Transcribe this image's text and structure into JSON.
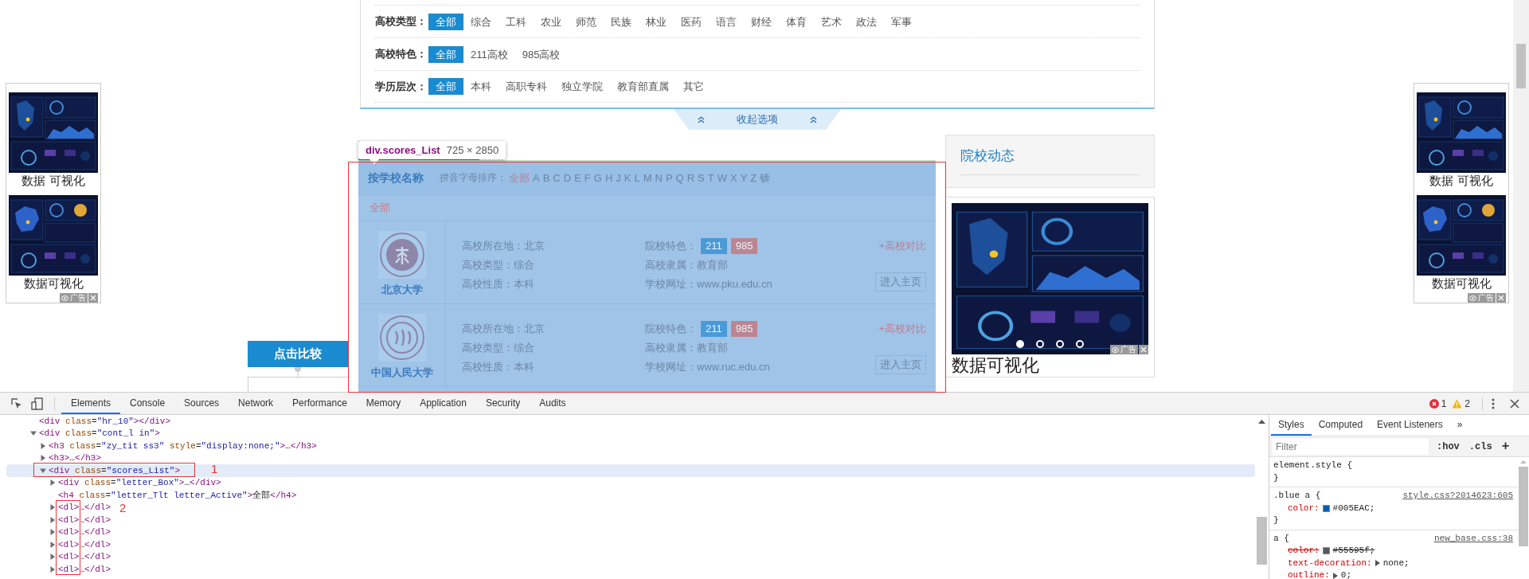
{
  "page": {
    "filters": [
      {
        "label": "高校类型：",
        "options": [
          {
            "label": "全部",
            "selected": true
          },
          {
            "label": "综合",
            "selected": false
          },
          {
            "label": "工科",
            "selected": false
          },
          {
            "label": "农业",
            "selected": false
          },
          {
            "label": "师范",
            "selected": false
          },
          {
            "label": "民族",
            "selected": false
          },
          {
            "label": "林业",
            "selected": false
          },
          {
            "label": "医药",
            "selected": false
          },
          {
            "label": "语言",
            "selected": false
          },
          {
            "label": "财经",
            "selected": false
          },
          {
            "label": "体育",
            "selected": false
          },
          {
            "label": "艺术",
            "selected": false
          },
          {
            "label": "政法",
            "selected": false
          },
          {
            "label": "军事",
            "selected": false
          }
        ]
      },
      {
        "label": "高校特色：",
        "options": [
          {
            "label": "全部",
            "selected": true
          },
          {
            "label": "211高校",
            "selected": false
          },
          {
            "label": "985高校",
            "selected": false
          }
        ]
      },
      {
        "label": "学历层次：",
        "options": [
          {
            "label": "全部",
            "selected": true
          },
          {
            "label": "本科",
            "selected": false
          },
          {
            "label": "高职专科",
            "selected": false
          },
          {
            "label": "独立学院",
            "selected": false
          },
          {
            "label": "教育部直属",
            "selected": false
          },
          {
            "label": "其它",
            "selected": false
          }
        ]
      }
    ],
    "collapse_button": "收起选项",
    "scores_list": {
      "title": "按学校名称",
      "sort_label": "拼音字母排序：",
      "letters": [
        {
          "label": "全部",
          "selected": true
        },
        {
          "label": "A",
          "selected": false
        },
        {
          "label": "B",
          "selected": false
        },
        {
          "label": "C",
          "selected": false
        },
        {
          "label": "D",
          "selected": false
        },
        {
          "label": "E",
          "selected": false
        },
        {
          "label": "F",
          "selected": false
        },
        {
          "label": "G",
          "selected": false
        },
        {
          "label": "H",
          "selected": false
        },
        {
          "label": "J",
          "selected": false
        },
        {
          "label": "K",
          "selected": false
        },
        {
          "label": "L",
          "selected": false
        },
        {
          "label": "M",
          "selected": false
        },
        {
          "label": "N",
          "selected": false
        },
        {
          "label": "P",
          "selected": false
        },
        {
          "label": "Q",
          "selected": false
        },
        {
          "label": "R",
          "selected": false
        },
        {
          "label": "S",
          "selected": false
        },
        {
          "label": "T",
          "selected": false
        },
        {
          "label": "W",
          "selected": false
        },
        {
          "label": "X",
          "selected": false
        },
        {
          "label": "Y",
          "selected": false
        },
        {
          "label": "Z",
          "selected": false
        },
        {
          "label": "锛",
          "selected": false
        }
      ],
      "group_title": "全部",
      "schools": [
        {
          "name": "北京大学",
          "info": [
            "高校所在地：北京",
            "高校类型：综合",
            "高校性质：本科"
          ],
          "features_label": "院校特色：",
          "badges": [
            {
              "label": "211",
              "color": "#4a9ad8"
            },
            {
              "label": "985",
              "color": "#bc8592"
            }
          ],
          "affiliation": "高校隶属：教育部",
          "website": "学校网址：www.pku.edu.cn",
          "compare_link": "+高校对比",
          "homepage_button": "进入主页"
        },
        {
          "name": "中国人民大学",
          "info": [
            "高校所在地：北京",
            "高校类型：综合",
            "高校性质：本科"
          ],
          "features_label": "院校特色：",
          "badges": [
            {
              "label": "211",
              "color": "#4a9ad8"
            },
            {
              "label": "985",
              "color": "#bc8592"
            }
          ],
          "affiliation": "高校隶属：教育部",
          "website": "学校网址：www.ruc.edu.cn",
          "compare_link": "+高校对比",
          "homepage_button": "进入主页"
        }
      ]
    },
    "news_title": "院校动态",
    "right_ad": {
      "caption": "数据可视化",
      "badge": "广告",
      "slides": [
        {
          "selected": true
        },
        {
          "selected": false
        },
        {
          "selected": false
        },
        {
          "selected": false
        }
      ]
    },
    "side_ads": [
      {
        "captions": [
          "数据 可视化",
          "数据可视化"
        ],
        "badge": "广告"
      },
      {
        "captions": [
          "数据 可视化",
          "数据可视化"
        ],
        "badge": "广告"
      }
    ],
    "compare_button": "点击比较"
  },
  "inspector_tooltip": {
    "selector": "div.scores_List",
    "size": "725 × 2850"
  },
  "annotations": [
    {
      "label": "1"
    },
    {
      "label": "2"
    }
  ],
  "devtools": {
    "tabs": [
      {
        "label": "Elements",
        "selected": true
      },
      {
        "label": "Console",
        "selected": false
      },
      {
        "label": "Sources",
        "selected": false
      },
      {
        "label": "Network",
        "selected": false
      },
      {
        "label": "Performance",
        "selected": false
      },
      {
        "label": "Memory",
        "selected": false
      },
      {
        "label": "Application",
        "selected": false
      },
      {
        "label": "Security",
        "selected": false
      },
      {
        "label": "Audits",
        "selected": false
      }
    ],
    "errors": "1",
    "warnings": "2",
    "dom_tree": [
      {
        "markup": "<div class=\"hr_10\"></div>",
        "selected": false
      },
      {
        "markup": "<div class=\"cont_l in\">",
        "expanded": true,
        "selected": false,
        "children": [
          {
            "markup": "<h3 class=\"zy_tit ss3\" style=\"display:none;\">…</h3>",
            "expanded": false,
            "selected": false
          },
          {
            "markup": "<h3>…</h3>",
            "expanded": false,
            "selected": false
          },
          {
            "markup": "<div class=\"scores_List\">",
            "expanded": true,
            "selected": true,
            "children": [
              {
                "markup": "<div class=\"letter_Box\">…</div>",
                "expanded": false,
                "selected": false
              },
              {
                "markup": "<h4 class=\"letter_Tlt letter_Active\">全部</h4>",
                "selected": false
              },
              {
                "markup": "<dl>…</dl>",
                "expanded": false,
                "selected": false
              },
              {
                "markup": "<dl>…</dl>",
                "expanded": false,
                "selected": false
              },
              {
                "markup": "<dl>…</dl>",
                "expanded": false,
                "selected": false
              },
              {
                "markup": "<dl>…</dl>",
                "expanded": false,
                "selected": false
              },
              {
                "markup": "<dl>…</dl>",
                "expanded": false,
                "selected": false
              },
              {
                "markup": "<dl>…</dl>",
                "expanded": false,
                "selected": false
              }
            ]
          }
        ]
      }
    ],
    "styles_tabs": [
      {
        "label": "Styles",
        "selected": true
      },
      {
        "label": "Computed",
        "selected": false
      },
      {
        "label": "Event Listeners",
        "selected": false
      }
    ],
    "more_tabs": "»",
    "filter_placeholder": "Filter",
    "hov": ":hov",
    "cls": ".cls",
    "add": "+",
    "rules": [
      {
        "header": "element.style {",
        "close": "}"
      },
      {
        "header": ".blue a {",
        "source": "style.css?2014623:605",
        "close": "}",
        "declarations": [
          {
            "property": "color:",
            "value": "#005EAC;",
            "color": "#005eac",
            "overridden": false,
            "expandable": false
          }
        ]
      },
      {
        "header": "a {",
        "source": "new_base.css:38",
        "declarations": [
          {
            "property": "color:",
            "value": "#55595f;",
            "color": "#55595f",
            "overridden": true,
            "expandable": false
          },
          {
            "property": "text-decoration:",
            "value": "none;",
            "overridden": false,
            "expandable": true
          },
          {
            "property": "outline:",
            "value": "0;",
            "overridden": false,
            "expandable": true
          }
        ]
      }
    ]
  }
}
